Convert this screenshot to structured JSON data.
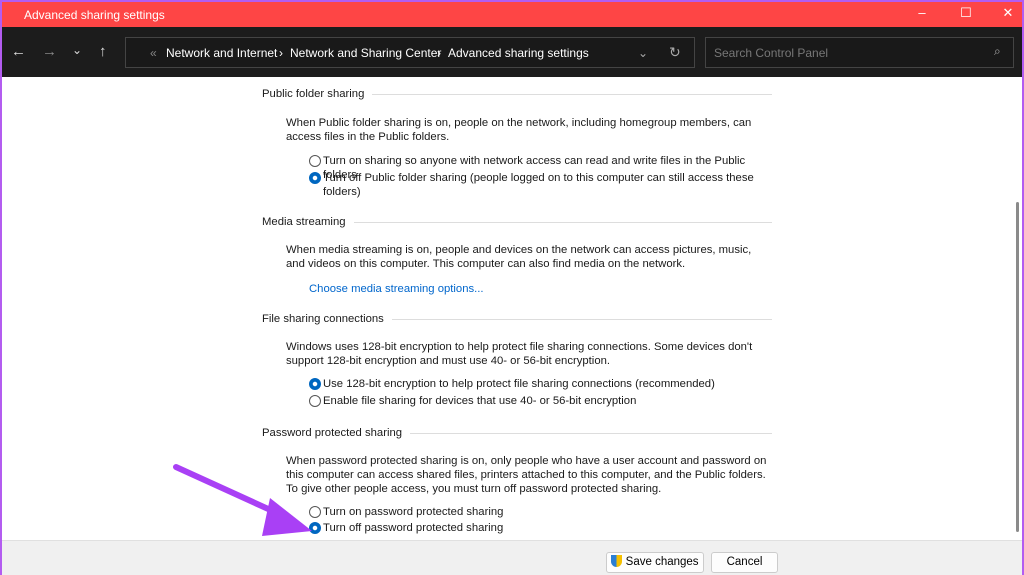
{
  "window": {
    "title": "Advanced sharing settings",
    "minimize": "–",
    "maximize": "☐",
    "close": "✕"
  },
  "nav": {
    "back": "←",
    "forward": "→",
    "recent": "⌄",
    "up": "↑",
    "breadcrumb": [
      "Network and Internet",
      "Network and Sharing Center",
      "Advanced sharing settings"
    ],
    "search_placeholder": "Search Control Panel"
  },
  "sections": {
    "public": {
      "title": "Public folder sharing",
      "desc": "When Public folder sharing is on, people on the network, including homegroup members, can access files in the Public folders.",
      "opt1": "Turn on sharing so anyone with network access can read and write files in the Public folders",
      "opt2": "Turn off Public folder sharing (people logged on to this computer can still access these folders)",
      "selected": 2
    },
    "media": {
      "title": "Media streaming",
      "desc": "When media streaming is on, people and devices on the network can access pictures, music, and videos on this computer. This computer can also find media on the network.",
      "link": "Choose media streaming options..."
    },
    "file": {
      "title": "File sharing connections",
      "desc": "Windows uses 128-bit encryption to help protect file sharing connections. Some devices don't support 128-bit encryption and must use 40- or 56-bit encryption.",
      "opt1": "Use 128-bit encryption to help protect file sharing connections (recommended)",
      "opt2": "Enable file sharing for devices that use 40- or 56-bit encryption",
      "selected": 1
    },
    "password": {
      "title": "Password protected sharing",
      "desc": "When password protected sharing is on, only people who have a user account and password on this computer can access shared files, printers attached to this computer, and the Public folders. To give other people access, you must turn off password protected sharing.",
      "opt1": "Turn on password protected sharing",
      "opt2": "Turn off password protected sharing",
      "selected": 2
    }
  },
  "footer": {
    "save": "Save changes",
    "cancel": "Cancel"
  },
  "colors": {
    "titlebar": "#fe4545",
    "arrow": "#a940f5",
    "accent": "#0067c0"
  }
}
